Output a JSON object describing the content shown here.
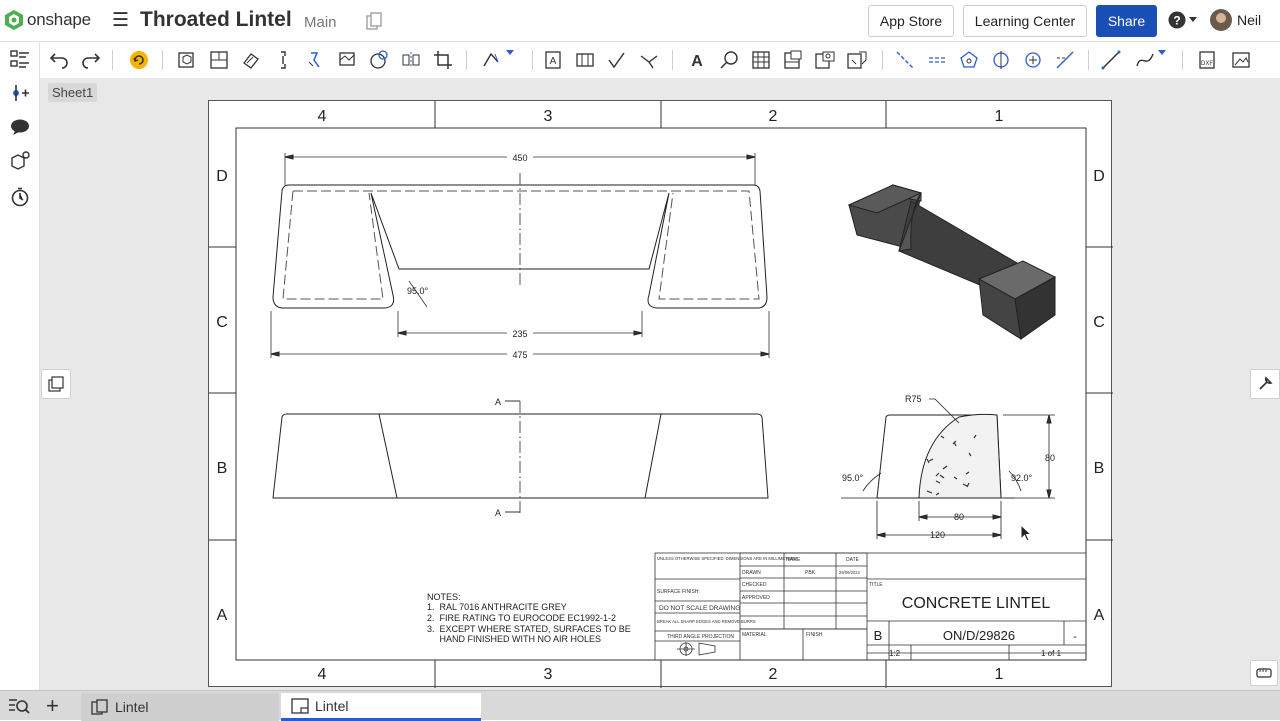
{
  "app": {
    "logo_text": "onshape",
    "document_title": "Throated Lintel",
    "branch": "Main"
  },
  "header_buttons": {
    "app_store": "App Store",
    "learning_center": "Learning Center",
    "share": "Share"
  },
  "user": {
    "name": "Neil"
  },
  "sheet": {
    "name": "Sheet1"
  },
  "drawing": {
    "zone_columns": [
      "4",
      "3",
      "2",
      "1"
    ],
    "zone_rows": [
      "D",
      "C",
      "B",
      "A"
    ],
    "dims": {
      "top_width": "450",
      "inner_width": "235",
      "overall_width": "475",
      "angle_top": "95.0°",
      "side_radius": "R75",
      "side_height": "80",
      "side_inner": "80",
      "side_base": "120",
      "side_left_angle": "95.0°",
      "side_right_angle": "92.0°",
      "section": "A"
    },
    "notes": {
      "heading": "NOTES:",
      "lines": [
        "1.  RAL 7016 ANTHRACITE GREY",
        "2.  FIRE RATING TO EUROCODE EC1992-1-2",
        "3.  EXCEPT WHERE STATED, SURFACES TO BE",
        "     HAND FINISHED WITH NO AIR HOLES"
      ]
    },
    "title_block": {
      "unless": "UNLESS OTHERWISE SPECIFIED: DIMENSIONS ARE IN MILLIMETERS",
      "surface_finish": "SURFACE FINISH:",
      "do_not_scale": "DO NOT SCALE DRAWING",
      "break_edges": "BREAK ALL SHARP EDGES AND REMOVE BURRS",
      "projection": "THIRD ANGLE PROJECTION",
      "name_col": "NAME",
      "date_col": "DATE",
      "drawn": "DRAWN",
      "drawn_name": "PBK",
      "drawn_date": "29/06/2022",
      "checked": "CHECKED",
      "approved": "APPROVED",
      "material": "MATERIAL",
      "finish": "FINISH",
      "title_label": "TITLE",
      "title": "CONCRETE LINTEL",
      "size": "B",
      "dwg_no": "ON/D/29826",
      "rev": "-",
      "scale": "1:2",
      "sheet": "1 of 1"
    }
  },
  "bottom_tabs": [
    {
      "label": "Lintel"
    },
    {
      "label": "Lintel"
    }
  ],
  "colors": {
    "share_bg": "#1a4fb5",
    "active_tab_underline": "#2a5bd7",
    "logo_green": "#4caf50"
  }
}
